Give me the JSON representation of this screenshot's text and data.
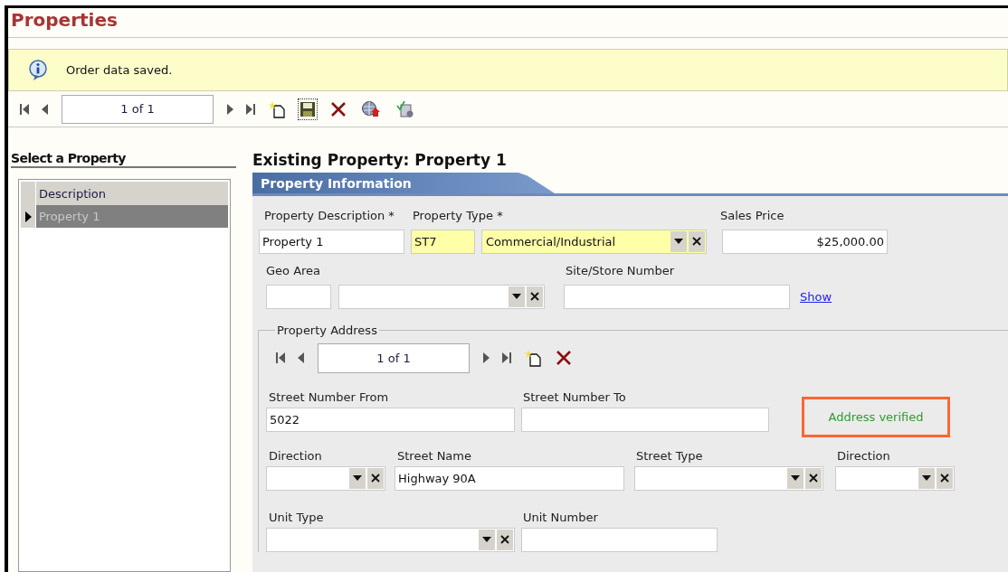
{
  "header": {
    "title": "Properties"
  },
  "message": {
    "kind": "info",
    "text": "Order data saved."
  },
  "navigator": {
    "position": "1 of 1"
  },
  "list": {
    "title": "Select a Property",
    "columns": [
      "Description"
    ],
    "rows": [
      {
        "description": "Property 1",
        "selected": true
      }
    ]
  },
  "detail": {
    "heading": "Existing Property: Property 1",
    "tab": "Property Information",
    "property_description": {
      "label": "Property Description *",
      "value": "Property 1",
      "highlighted": false
    },
    "property_type": {
      "label": "Property Type *",
      "code": "ST7",
      "value": "Commercial/Industrial",
      "highlighted": true
    },
    "sales_price": {
      "label": "Sales Price",
      "value": "$25,000.00",
      "highlighted": false
    },
    "geo_area": {
      "label": "Geo Area"
    },
    "site_store_number": {
      "label": "Site/Store Number",
      "link": "Show"
    },
    "address": {
      "legend": "Property Address",
      "position": "1 of 1",
      "street_number_from": {
        "label": "Street Number From",
        "value": "5022"
      },
      "street_number_to": {
        "label": "Street Number To"
      },
      "verification": {
        "text": "Address verified",
        "verified": true
      },
      "direction": {
        "label": "Direction"
      },
      "street_name": {
        "label": "Street Name",
        "value": "Highway 90A"
      },
      "street_type": {
        "label": "Street Type"
      },
      "post_direction": {
        "label": "Direction"
      },
      "unit_type": {
        "label": "Unit Type"
      },
      "unit_number": {
        "label": "Unit Number"
      }
    }
  }
}
